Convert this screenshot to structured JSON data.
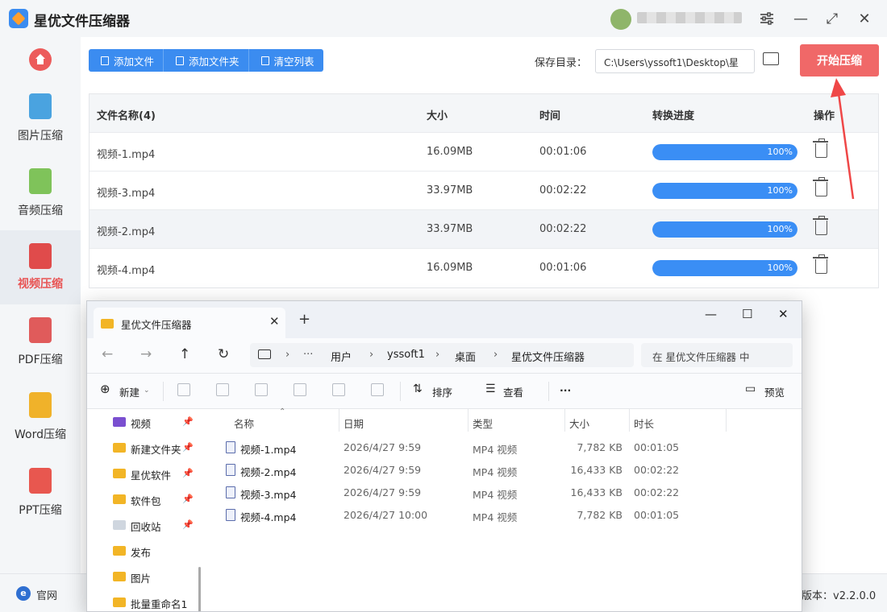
{
  "app": {
    "title": "星优文件压缩器",
    "version": "版本：v2.2.0.0",
    "site_label": "官网"
  },
  "titlebar": {
    "settings_icon": "sliders-icon",
    "minimize": "—",
    "maximize": "⤢",
    "close": "✕"
  },
  "sidebar": {
    "items": [
      {
        "label": "图片压缩",
        "icon": "image-icon",
        "color": "#4aa3e0"
      },
      {
        "label": "音频压缩",
        "icon": "audio-icon",
        "color": "#7fc35a"
      },
      {
        "label": "视频压缩",
        "icon": "video-icon",
        "color": "#e04b4b"
      },
      {
        "label": "PDF压缩",
        "icon": "pdf-icon",
        "color": "#e05b5b"
      },
      {
        "label": "Word压缩",
        "icon": "word-icon",
        "color": "#f0b22a"
      },
      {
        "label": "PPT压缩",
        "icon": "ppt-icon",
        "color": "#e8574f"
      }
    ]
  },
  "toolbar": {
    "add_file": "添加文件",
    "add_folder": "添加文件夹",
    "clear_list": "清空列表",
    "save_label": "保存目录：",
    "save_path": "C:\\Users\\yssoft1\\Desktop\\星",
    "start": "开始压缩"
  },
  "table": {
    "headers": [
      "文件名称(4)",
      "大小",
      "时间",
      "转换进度",
      "操作"
    ],
    "rows": [
      {
        "name": "视频-1.mp4",
        "size": "16.09MB",
        "time": "00:01:06",
        "progress_text": "100%",
        "progress": 1.0
      },
      {
        "name": "视频-3.mp4",
        "size": "33.97MB",
        "time": "00:02:22",
        "progress_text": "100%",
        "progress": 1.0
      },
      {
        "name": "视频-2.mp4",
        "size": "33.97MB",
        "time": "00:02:22",
        "progress_text": "100%",
        "progress": 1.0
      },
      {
        "name": "视频-4.mp4",
        "size": "16.09MB",
        "time": "00:01:06",
        "progress_text": "100%",
        "progress": 1.0
      }
    ]
  },
  "explorer": {
    "tab_title": "星优文件压缩器",
    "tab_close": "✕",
    "new_tab": "+",
    "breadcrumb": [
      "用户",
      "yssoft1",
      "桌面",
      "星优文件压缩器"
    ],
    "more": "···",
    "search_placeholder": "在 星优文件压缩器 中",
    "commands": {
      "new": "新建",
      "sort": "排序",
      "view": "查看",
      "more": "···",
      "preview": "预览"
    },
    "nav_items": [
      {
        "label": "视频",
        "pinned": true
      },
      {
        "label": "新建文件夹",
        "pinned": true
      },
      {
        "label": "星优软件",
        "pinned": true
      },
      {
        "label": "软件包",
        "pinned": true
      },
      {
        "label": "回收站",
        "pinned": true
      },
      {
        "label": "发布",
        "pinned": false
      },
      {
        "label": "图片",
        "pinned": false
      },
      {
        "label": "批量重命名1",
        "pinned": false
      }
    ],
    "columns": [
      "名称",
      "日期",
      "类型",
      "大小",
      "时长"
    ],
    "files": [
      {
        "name": "视频-1.mp4",
        "date": "2026/4/27 9:59",
        "type": "MP4 视频",
        "size": "7,782 KB",
        "duration": "00:01:05"
      },
      {
        "name": "视频-2.mp4",
        "date": "2026/4/27 9:59",
        "type": "MP4 视频",
        "size": "16,433 KB",
        "duration": "00:02:22"
      },
      {
        "name": "视频-3.mp4",
        "date": "2026/4/27 9:59",
        "type": "MP4 视频",
        "size": "16,433 KB",
        "duration": "00:02:22"
      },
      {
        "name": "视频-4.mp4",
        "date": "2026/4/27 10:00",
        "type": "MP4 视频",
        "size": "7,782 KB",
        "duration": "00:01:05"
      }
    ]
  },
  "colors": {
    "accent": "#3b8cf0",
    "start_button": "#f06868",
    "active_sidebar_text": "#e85454",
    "progress": "#3a8ef5",
    "annotation_arrow": "#ef4747"
  }
}
